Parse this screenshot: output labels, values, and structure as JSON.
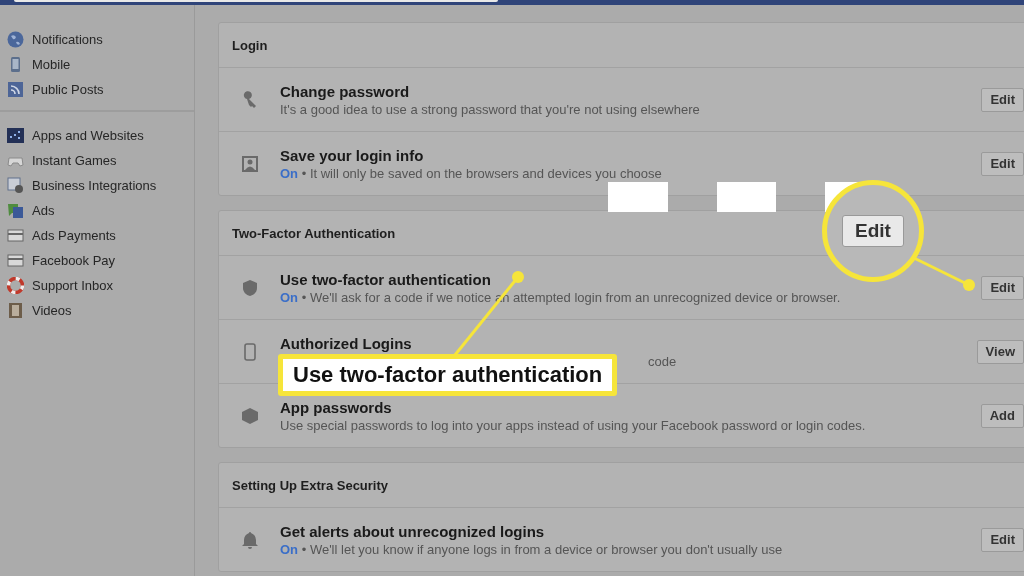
{
  "sidebar": {
    "groups": [
      {
        "items": [
          {
            "label": "Notifications"
          },
          {
            "label": "Mobile"
          },
          {
            "label": "Public Posts"
          }
        ]
      },
      {
        "items": [
          {
            "label": "Apps and Websites"
          },
          {
            "label": "Instant Games"
          },
          {
            "label": "Business Integrations"
          },
          {
            "label": "Ads"
          },
          {
            "label": "Ads Payments"
          },
          {
            "label": "Facebook Pay"
          },
          {
            "label": "Support Inbox"
          },
          {
            "label": "Videos"
          }
        ]
      }
    ]
  },
  "sections": [
    {
      "title": "Login",
      "rows": [
        {
          "title": "Change password",
          "description": "It's a good idea to use a strong password that you're not using elsewhere",
          "button": "Edit"
        },
        {
          "title": "Save your login info",
          "status": "On",
          "separator": "•",
          "description": "It will only be saved on the browsers and devices you choose",
          "button": "Edit"
        }
      ]
    },
    {
      "title": "Two-Factor Authentication",
      "rows": [
        {
          "title": "Use two-factor authentication",
          "status": "On",
          "separator": "•",
          "description": "We'll ask for a code if we notice an attempted login from an unrecognized device or browser.",
          "button": "Edit"
        },
        {
          "title": "Authorized Logins",
          "description": "code",
          "covered": true,
          "button": "View"
        },
        {
          "title": "App passwords",
          "description": "Use special passwords to log into your apps instead of using your Facebook password or login codes.",
          "button": "Add"
        }
      ]
    },
    {
      "title": "Setting Up Extra Security",
      "rows": [
        {
          "title": "Get alerts about unrecognized logins",
          "status": "On",
          "separator": "•",
          "description": "We'll let you know if anyone logs in from a device or browser you don't usually use",
          "button": "Edit"
        }
      ]
    }
  ],
  "annotations": {
    "magnified_button": "Edit",
    "callout": "Use two-factor authentication"
  }
}
